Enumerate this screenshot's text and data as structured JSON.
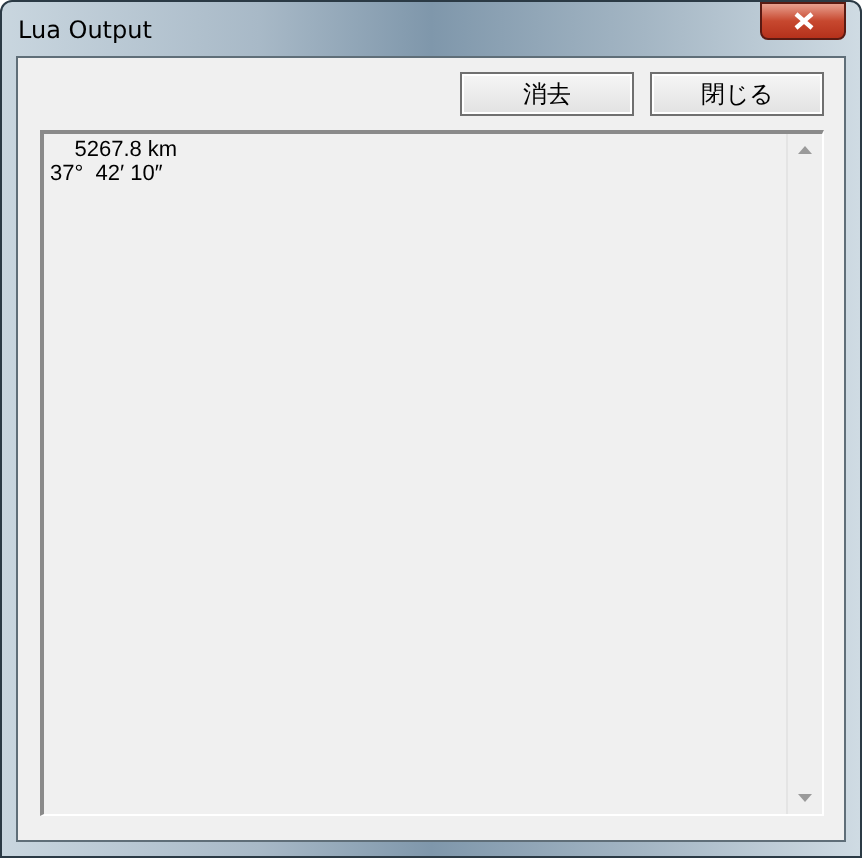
{
  "window": {
    "title": "Lua Output"
  },
  "buttons": [
    {
      "label": "消去"
    },
    {
      "label": "閉じる"
    }
  ],
  "output": {
    "lines": [
      "    5267.8 km",
      "37°  42′ 10″"
    ]
  }
}
